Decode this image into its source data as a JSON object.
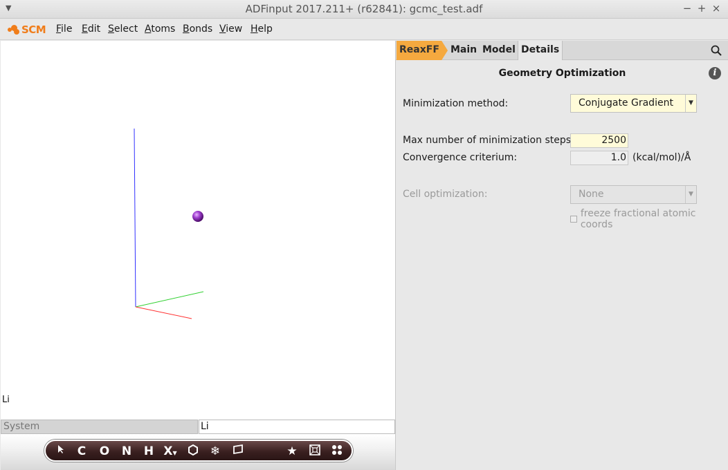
{
  "window": {
    "title": "ADFinput 2017.211+ (r62841): gcmc_test.adf",
    "controls": {
      "minimize": "−",
      "maximize": "+",
      "close": "×"
    }
  },
  "menubar": {
    "logo": "SCM",
    "items": [
      {
        "label": "File",
        "mnemonic": "F",
        "rest": "ile"
      },
      {
        "label": "Edit",
        "mnemonic": "E",
        "rest": "dit"
      },
      {
        "label": "Select",
        "mnemonic": "S",
        "rest": "elect"
      },
      {
        "label": "Atoms",
        "mnemonic": "A",
        "rest": "toms"
      },
      {
        "label": "Bonds",
        "mnemonic": "B",
        "rest": "onds"
      },
      {
        "label": "View",
        "mnemonic": "V",
        "rest": "iew"
      },
      {
        "label": "Help",
        "mnemonic": "H",
        "rest": "elp"
      }
    ]
  },
  "viewport": {
    "atom_label": "Li",
    "atom_color": "#8b2fb0",
    "axis_colors": {
      "x": "#ff3030",
      "y": "#30d030",
      "z": "#3030ff"
    }
  },
  "statusbar": {
    "left": "System",
    "right": "Li"
  },
  "toolbar": {
    "tools": [
      "cursor-tool",
      "C",
      "O",
      "N",
      "H",
      "X",
      "ring-tool",
      "snowflake-tool",
      "plane-tool",
      "star-tool",
      "box-tool",
      "molecule-tool"
    ]
  },
  "panel": {
    "tabs": {
      "reaxff": "ReaxFF",
      "main": "Main",
      "model": "Model",
      "details": "Details"
    },
    "heading": "Geometry Optimization",
    "fields": {
      "minimization_method_label": "Minimization method:",
      "minimization_method_value": "Conjugate Gradient",
      "max_steps_label": "Max number of minimization steps:",
      "max_steps_value": "2500",
      "convergence_label": "Convergence criterium:",
      "convergence_value": "1.0",
      "convergence_unit": "(kcal/mol)/Å",
      "cell_opt_label": "Cell optimization:",
      "cell_opt_value": "None",
      "freeze_label": "freeze fractional atomic coords"
    },
    "accent_color": "#f5a93f"
  }
}
